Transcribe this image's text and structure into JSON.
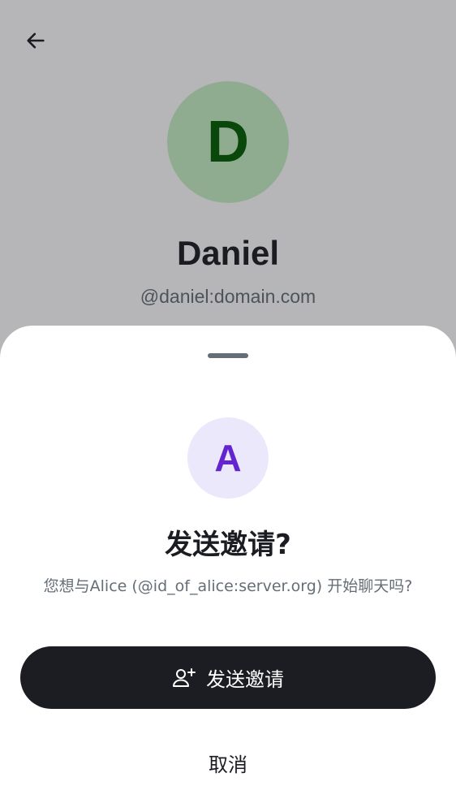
{
  "profile": {
    "back_icon": "arrow-left-icon",
    "avatar_letter": "D",
    "name": "Daniel",
    "user_id": "@daniel:domain.com"
  },
  "sheet": {
    "avatar_letter": "A",
    "title": "发送邀请?",
    "message": "您想与Alice (@id_of_alice:server.org) 开始聊天吗?",
    "primary_button": {
      "icon": "user-add-icon",
      "label": "发送邀请"
    },
    "cancel_label": "取消"
  },
  "colors": {
    "scrim": "#1b1d22",
    "profile_avatar_bg": "#c8f1c4",
    "profile_avatar_fg": "#005c00",
    "invite_avatar_bg": "#ece8fc",
    "invite_avatar_fg": "#6425d0",
    "primary_button_bg": "#1b1d22",
    "secondary_text": "#656d77"
  }
}
